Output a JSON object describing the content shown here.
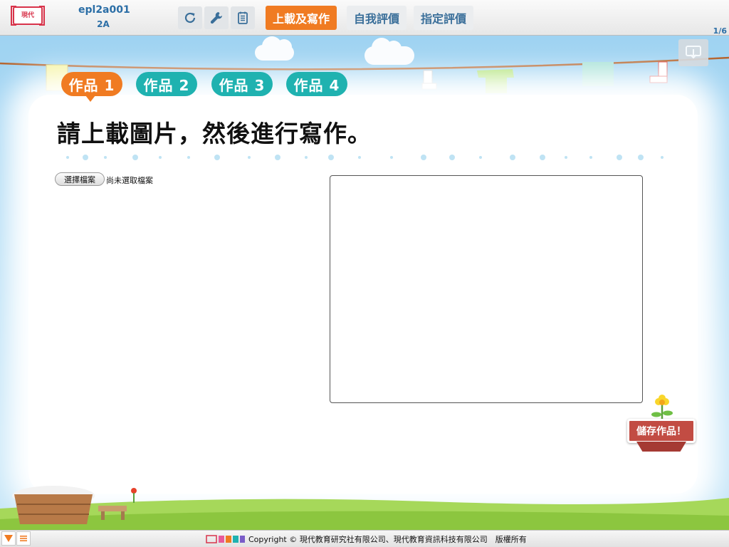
{
  "app": {
    "logo_text": "現代",
    "user_id": "epl2a001",
    "user_class": "2A",
    "page_count": "1/6"
  },
  "toolbar": {
    "tools": [
      {
        "icon": "refresh-icon"
      },
      {
        "icon": "wrench-icon"
      },
      {
        "icon": "notepad-icon"
      }
    ],
    "tabs": [
      {
        "label": "上載及寫作",
        "active": true
      },
      {
        "label": "自我評價",
        "active": false
      },
      {
        "label": "指定評價",
        "active": false
      }
    ]
  },
  "work_tabs": [
    {
      "label": "作品 1",
      "active": true
    },
    {
      "label": "作品 2",
      "active": false
    },
    {
      "label": "作品 3",
      "active": false
    },
    {
      "label": "作品 4",
      "active": false
    }
  ],
  "main": {
    "instruction": "請上載圖片，然後進行寫作。",
    "file_button": "選擇檔案",
    "file_status": "尚未選取檔案",
    "writing_value": "",
    "save_button": "儲存作品！"
  },
  "footer": {
    "copyright": "Copyright © 現代教育研究社有限公司、現代教育資訊科技有限公司　版權所有",
    "menu_icon": "menu-icon",
    "toggle_icon": "triangle-down-icon"
  },
  "colors": {
    "accent": "#f07b22",
    "teal": "#1fb2b0",
    "brand_red": "#d8334a",
    "tab_text": "#3a6f9a"
  }
}
